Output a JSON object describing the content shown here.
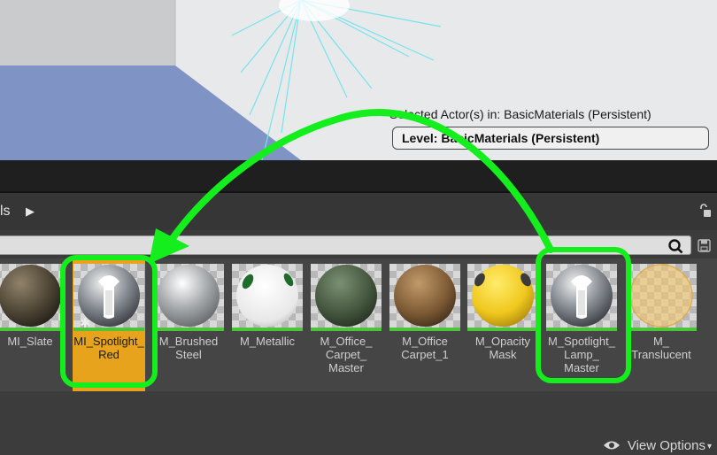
{
  "viewport": {
    "selected_actors_label": "Selected Actor(s) in:",
    "selected_actors_value": "BasicMaterials (Persistent)",
    "level_label": "Level:",
    "level_value": "BasicMaterials (Persistent)"
  },
  "content_browser": {
    "path_text": "ls",
    "path_arrow": "▶",
    "search_placeholder": "",
    "tiles": [
      {
        "label": "MI_Slate"
      },
      {
        "label": "MI_Spotlight_\nRed"
      },
      {
        "label": "M_Brushed\nSteel"
      },
      {
        "label": "M_Metallic"
      },
      {
        "label": "M_Office_\nCarpet_\nMaster"
      },
      {
        "label": "M_Office\nCarpet_1"
      },
      {
        "label": "M_Opacity\nMask"
      },
      {
        "label": "M_Spotlight_\nLamp_\nMaster"
      },
      {
        "label": "M_\nTranslucent"
      }
    ],
    "view_options": "View Options",
    "view_options_caret": "▾",
    "star_glyph": "✱"
  },
  "colors": {
    "highlight_green": "#13ee1c",
    "selected_tile": "#e8a31c",
    "asset_bar": "#4cc43a"
  }
}
